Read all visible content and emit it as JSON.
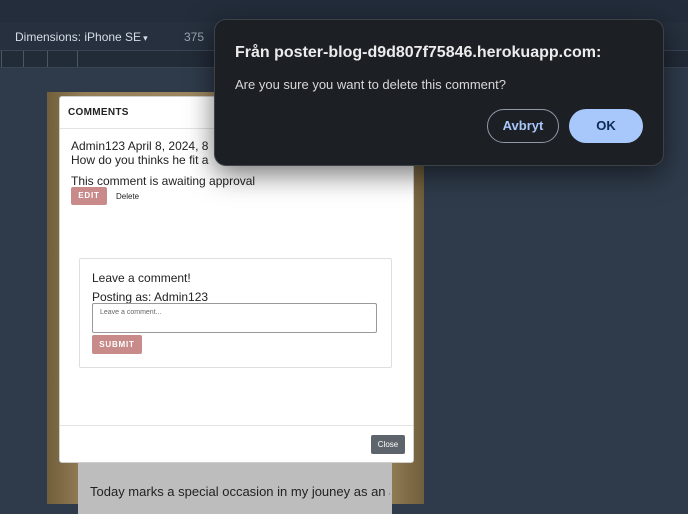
{
  "devtools": {
    "dimensions_label": "Dimensions: iPhone SE",
    "caret": "▾",
    "width_value": "375"
  },
  "page": {
    "background_text": "Today marks a special occasion in my jouney as an artist - a milestone that fills me with both pride and a"
  },
  "modal": {
    "title": "COMMENTS",
    "comment": {
      "meta": "Admin123 April 8, 2024, 8",
      "body": "How do you thinks he fit a",
      "status": "This comment is awaiting approval",
      "edit_label": "EDIT",
      "delete_label": "Delete"
    },
    "form": {
      "title": "Leave a comment!",
      "posting_as": "Posting as: Admin123",
      "input_placeholder": "Leave a comment...",
      "submit_label": "SUBMIT"
    },
    "close_label": "Close"
  },
  "dialog": {
    "title": "Från poster-blog-d9d807f75846.herokuapp.com:",
    "message": "Are you sure you want to delete this comment?",
    "cancel_label": "Avbryt",
    "ok_label": "OK"
  },
  "colors": {
    "accent_button": "#c98a8a",
    "dialog_primary": "#a8c7fa"
  }
}
